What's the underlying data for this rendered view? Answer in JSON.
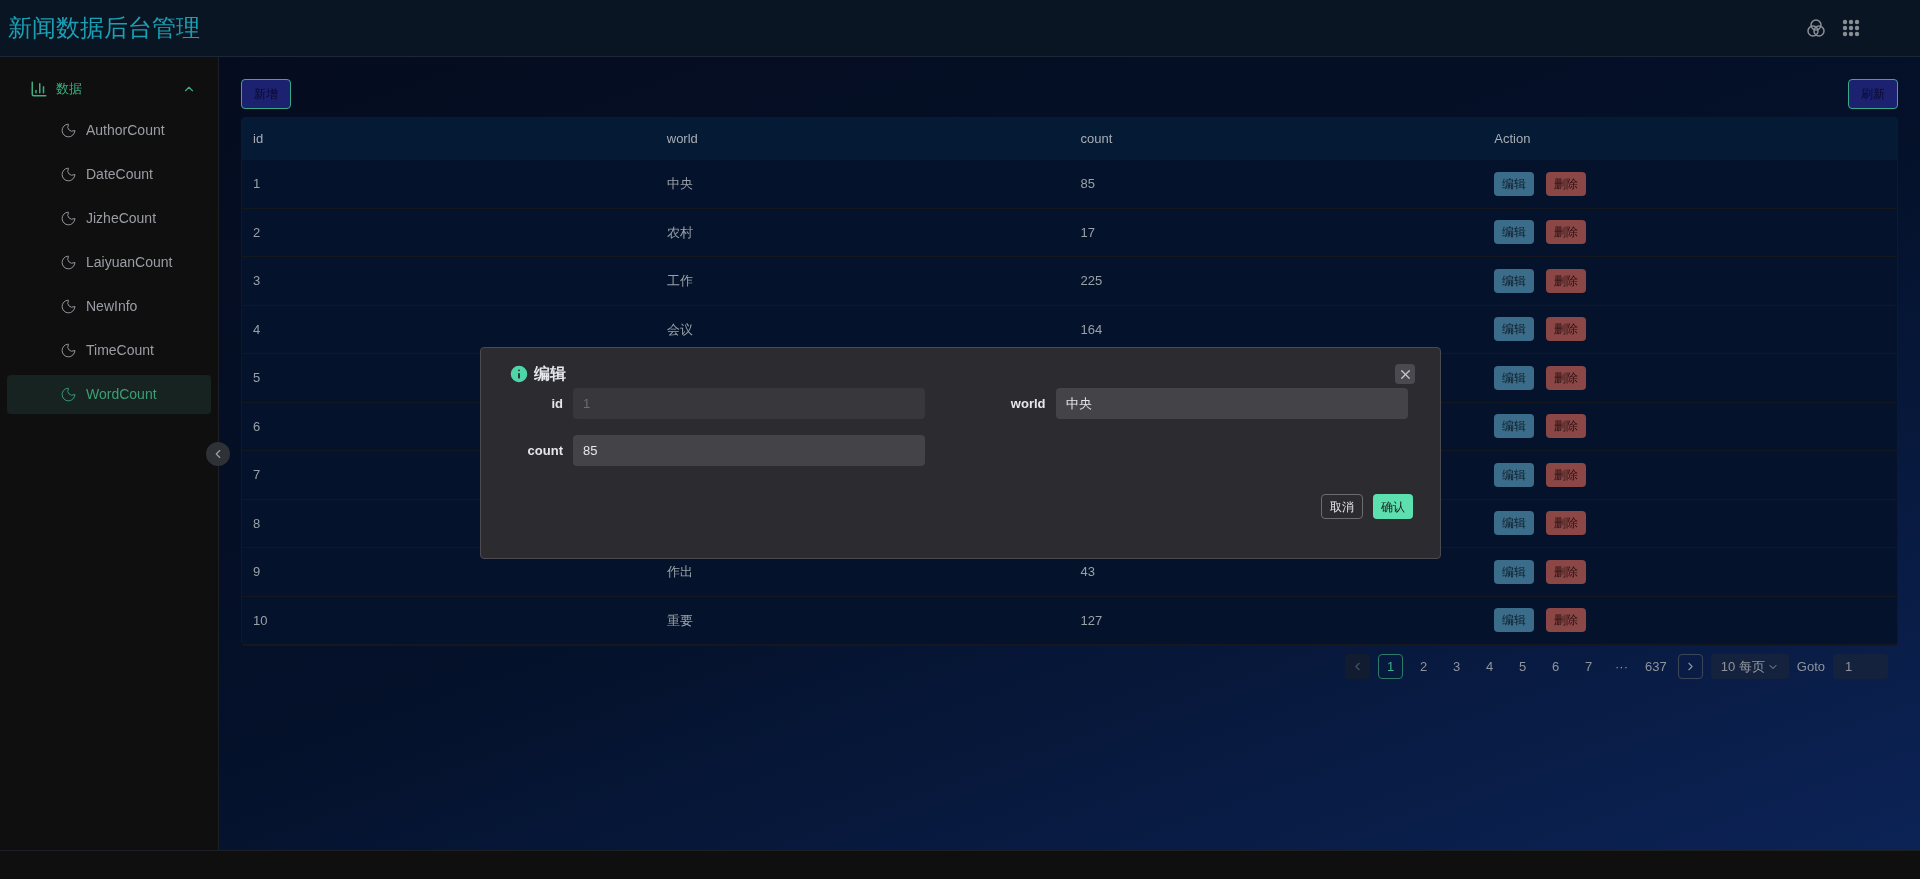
{
  "header": {
    "title": "新闻数据后台管理"
  },
  "sidebar": {
    "group": {
      "label": "数据",
      "expanded": true
    },
    "items": [
      {
        "label": "AuthorCount",
        "selected": false
      },
      {
        "label": "DateCount",
        "selected": false
      },
      {
        "label": "JizheCount",
        "selected": false
      },
      {
        "label": "LaiyuanCount",
        "selected": false
      },
      {
        "label": "NewInfo",
        "selected": false
      },
      {
        "label": "TimeCount",
        "selected": false
      },
      {
        "label": "WordCount",
        "selected": true
      }
    ]
  },
  "toolbar": {
    "add_button": "新增",
    "refresh_button": "刷新"
  },
  "table": {
    "columns": [
      "id",
      "world",
      "count",
      "Action"
    ],
    "rows": [
      {
        "id": "1",
        "world": "中央",
        "count": "85",
        "actions": [
          "编辑",
          "删除"
        ]
      },
      {
        "id": "2",
        "world": "农村",
        "count": "17",
        "actions": [
          "编辑",
          "删除"
        ]
      },
      {
        "id": "3",
        "world": "工作",
        "count": "225",
        "actions": [
          "编辑",
          "删除"
        ]
      },
      {
        "id": "4",
        "world": "会议",
        "count": "164",
        "actions": [
          "编辑",
          "删除"
        ]
      },
      {
        "id": "5",
        "actions": [
          "编辑",
          "删除"
        ]
      },
      {
        "id": "6",
        "actions": [
          "编辑",
          "删除"
        ]
      },
      {
        "id": "7",
        "actions": [
          "编辑",
          "删除"
        ]
      },
      {
        "id": "8",
        "actions": [
          "编辑",
          "删除"
        ]
      },
      {
        "id": "9",
        "world": "作出",
        "count": "43",
        "actions": [
          "编辑",
          "删除"
        ]
      },
      {
        "id": "10",
        "world": "重要",
        "count": "127",
        "actions": [
          "编辑",
          "删除"
        ]
      }
    ]
  },
  "pagination": {
    "prev_disabled": true,
    "pages": [
      {
        "label": "1",
        "selected": true
      },
      {
        "label": "2",
        "selected": false
      },
      {
        "label": "3",
        "selected": false
      },
      {
        "label": "4",
        "selected": false
      },
      {
        "label": "5",
        "selected": false
      },
      {
        "label": "6",
        "selected": false
      },
      {
        "label": "7",
        "selected": false
      },
      {
        "label": "···",
        "selected": false
      },
      {
        "label": "637",
        "selected": false
      }
    ],
    "page_size": "10 每页",
    "goto_label": "Goto",
    "goto_value": "1"
  },
  "dialog": {
    "title": "编辑",
    "fields": [
      {
        "label": "id",
        "value": "1",
        "disabled": true
      },
      {
        "label": "world",
        "value": "中央",
        "disabled": false
      },
      {
        "label": "count",
        "value": "85",
        "disabled": false
      }
    ],
    "cancel": "取消",
    "confirm": "确认"
  }
}
